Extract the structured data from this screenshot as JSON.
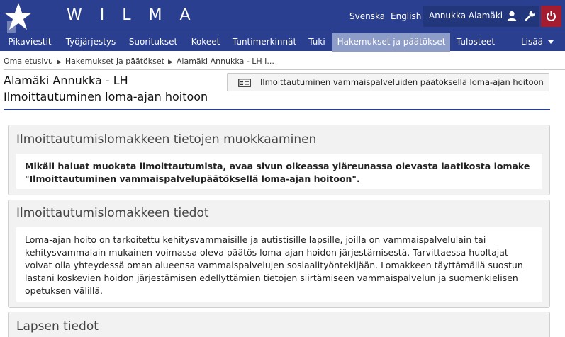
{
  "header": {
    "logo_text": "WILMA",
    "lang_fi": "Svenska",
    "lang_en": "English",
    "user_name": "Annukka Alamäki"
  },
  "nav": {
    "items": [
      "Pikaviestit",
      "Työjärjestys",
      "Suoritukset",
      "Kokeet",
      "Tuntimerkinnät",
      "Tuki",
      "Hakemukset ja päätökset",
      "Tulosteet"
    ],
    "more_label": "Lisää",
    "active_index": 6
  },
  "breadcrumb": {
    "items": [
      "Oma etusivu",
      "Hakemukset ja päätökset",
      "Alamäki Annukka - LH I..."
    ]
  },
  "page": {
    "title_line1": "Alamäki Annukka - LH",
    "title_line2": "Ilmoittautuminen loma-ajan hoitoon",
    "form_button_label": "Ilmoittautuminen vammaispalveluiden päätöksellä loma-ajan hoitoon"
  },
  "panels": {
    "edit": {
      "title": "Ilmoittautumislomakkeen tietojen muokkaaminen",
      "line1": "Mikäli haluat muokata ilmoittautumista, avaa sivun oikeassa yläreunassa olevasta laatikosta lomake",
      "line2": "\"Ilmoittautuminen vammaispalvelupäätöksellä loma-ajan hoitoon\"."
    },
    "info": {
      "title": "Ilmoittautumislomakkeen tiedot",
      "lines": [
        "Loma-ajan hoito on tarkoitettu kehitysvammaisille ja autistisille lapsille, joilla on vammaispalvelulain tai",
        "kehitysvammalain mukainen voimassa oleva päätös loma-ajan hoidon järjestämisestä. Tarvittaessa huoltajat",
        "voivat olla yhteydessä oman alueensa vammaispalvelujen sosiaalityöntekijään. Lomakkeen täyttämällä suostun",
        "lastani koskevien hoidon järjestämisen edellyttämien tietojen siirtämiseen vammaispalvelun ja suomenkielisen",
        "opetuksen välillä."
      ]
    },
    "child": {
      "title": "Lapsen tiedot"
    }
  },
  "colors": {
    "header_bg": "#2a3f8f",
    "nav_active": "#8e9dc8",
    "power_bg": "#a31c30",
    "panel_bg": "#f2f2f2"
  }
}
